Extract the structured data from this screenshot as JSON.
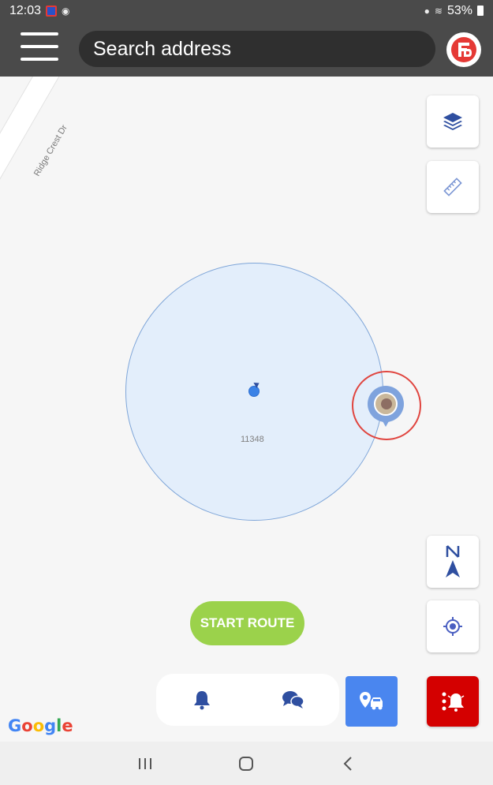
{
  "status_bar": {
    "time": "12:03",
    "battery": "53%"
  },
  "header": {
    "search": {
      "placeholder": "Search address"
    }
  },
  "map": {
    "road_label": "Ridge Crest Dr",
    "geofence_label": "11348"
  },
  "buttons": {
    "start_route": "START ROUTE"
  },
  "branding": {
    "google": [
      "G",
      "o",
      "o",
      "g",
      "l",
      "e"
    ]
  },
  "colors": {
    "header_bg": "#4a4a4a",
    "accent_blue": "#4a86ef",
    "icon_blue": "#2f4fa0",
    "start_route_green": "#9bd24b",
    "alarm_red": "#d40000",
    "geofence_fill": "#e3eefb"
  },
  "icons": {
    "menu": "hamburger-icon",
    "brand": "fleet-logo-icon",
    "layers": "layers-icon",
    "ruler": "ruler-icon",
    "compass": "north-compass-icon",
    "locate": "my-location-icon",
    "bell": "bell-icon",
    "chat": "chat-icon",
    "route": "route-car-icon",
    "alarm": "alarm-bell-icon"
  }
}
